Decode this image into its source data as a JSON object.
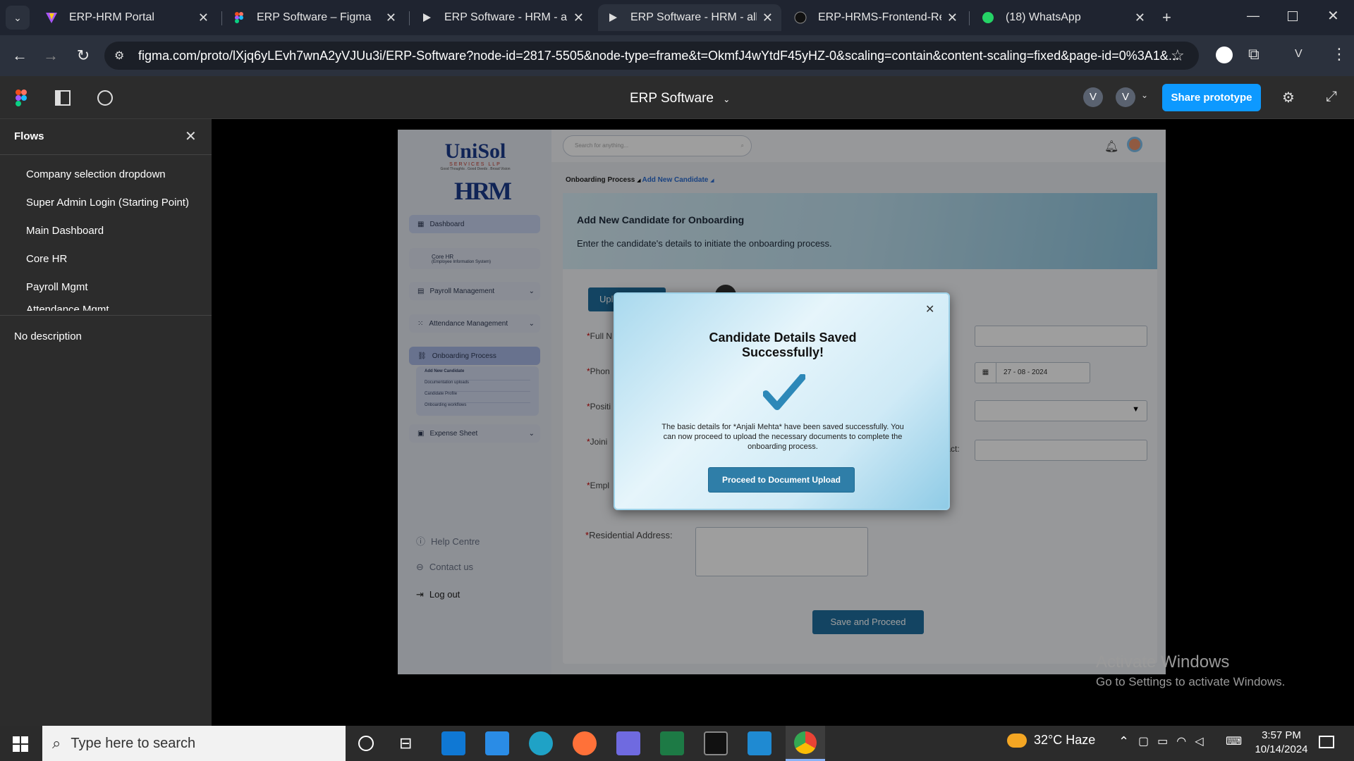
{
  "browser": {
    "tabs": [
      {
        "title": "ERP-HRM Portal",
        "icon": "vite-icon"
      },
      {
        "title": "ERP Software – Figma",
        "icon": "figma-icon"
      },
      {
        "title": "ERP Software - HRM - all c",
        "icon": "play-icon"
      },
      {
        "title": "ERP Software - HRM - all c",
        "icon": "play-icon",
        "active": true
      },
      {
        "title": "ERP-HRMS-Frontend-Reac",
        "icon": "github-icon"
      },
      {
        "title": "(18) WhatsApp",
        "icon": "whatsapp-icon"
      }
    ],
    "url": "figma.com/proto/lXjq6yLEvh7wnA2yVJUu3i/ERP-Software?node-id=2817-5505&node-type=frame&t=OkmfJ4wYtdF45yHZ-0&scaling=contain&content-scaling=fixed&page-id=0%3A1&...",
    "profile_initial": "V"
  },
  "figma": {
    "file_title": "ERP Software",
    "avatar_1": "V",
    "avatar_2": "V",
    "share_label": "Share prototype",
    "flows_title": "Flows",
    "flows": [
      "Company selection dropdown",
      "Super Admin Login (Starting Point)",
      "Main Dashboard",
      "Core HR",
      "Payroll Mgmt",
      "Attendance Mgmt"
    ],
    "description": "No description"
  },
  "app": {
    "logo_text": "UniSol",
    "logo_sub": "SERVICES LLP",
    "logo_tagline": "Good Thoughts . Good Deeds . Broad Vision",
    "hrm_logo": "HRM",
    "search_placeholder": "Search for anything...",
    "sidebar": {
      "dashboard": "Dashboard",
      "core_hr": "Core HR",
      "core_hr_sub": "(Employee Information System)",
      "payroll": "Payroll Management",
      "attendance": "Attendance Management",
      "onboarding": "Onboarding Process",
      "onboarding_sub": [
        "Add New Candidate",
        "Documentation uploads",
        "Candidate Profile",
        "Onboarding workflows"
      ],
      "expense": "Expense Sheet",
      "help": "Help Centre",
      "contact": "Contact us",
      "logout": "Log out"
    },
    "breadcrumb": {
      "root": "Onboarding Process",
      "current": "Add New Candidate"
    },
    "banner_title": "Add New Candidate for Onboarding",
    "banner_sub": "Enter the candidate's details to initiate the onboarding process.",
    "upload_label": "Upl",
    "labels": {
      "full_name": "Full N",
      "phone": "Phon",
      "position": "Positi",
      "joining": "Joini",
      "employee": "Empl",
      "contact": "tact:",
      "address": "Residential Address:"
    },
    "date_value": "27 - 08 - 2024",
    "save_button": "Save and Proceed"
  },
  "modal": {
    "title": "Candidate Details Saved Successfully!",
    "body": "The basic details for *Anjali Mehta* have been saved successfully. You can now proceed to upload the necessary documents to complete the onboarding process.",
    "button": "Proceed to Document Upload"
  },
  "watermark": {
    "line1": "Activate Windows",
    "line2": "Go to Settings to activate Windows."
  },
  "taskbar": {
    "search_placeholder": "Type here to search",
    "weather": "32°C  Haze",
    "time": "3:57 PM",
    "date": "10/14/2024"
  },
  "colors": {
    "accent": "#0d99ff",
    "tab_bg": "#1f2430",
    "figma_bar": "#2c2c2c",
    "sidebar_active": "#c9d3f0"
  }
}
